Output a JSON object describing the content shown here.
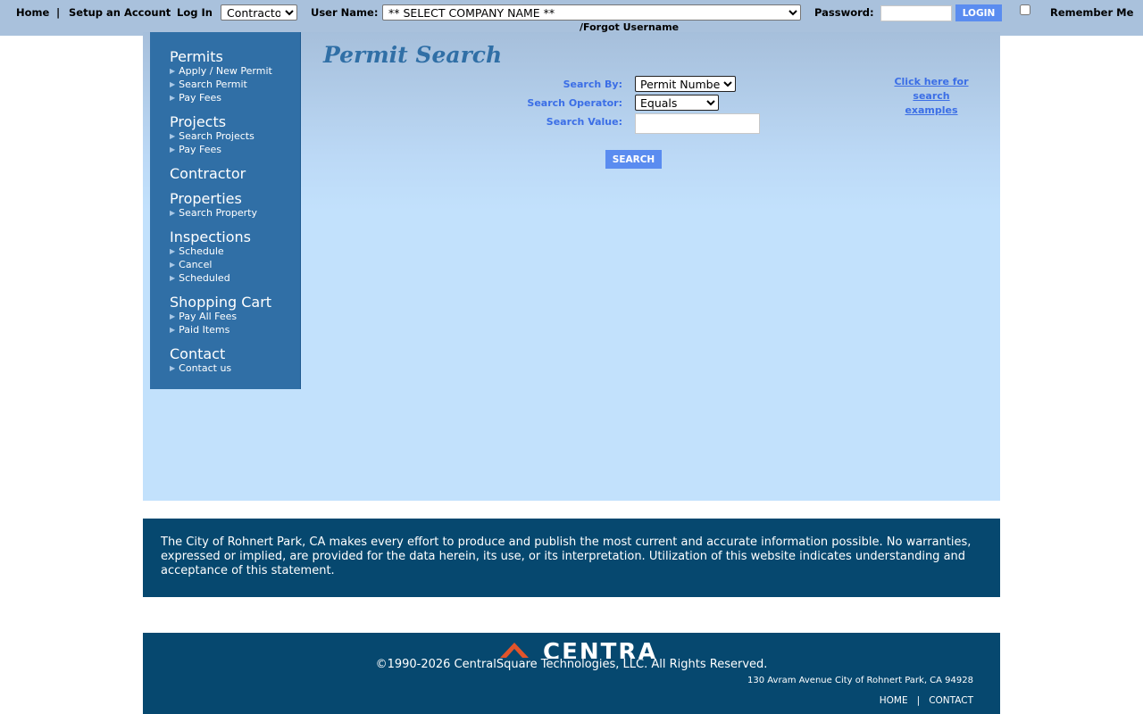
{
  "topbar": {
    "home": "Home",
    "sep1": "|",
    "setup": "Setup an Account",
    "login_label": "Log In",
    "login_type": "Contractor",
    "username_label": "User Name:",
    "company_select": "** SELECT COMPANY NAME **",
    "password_label": "Password:",
    "login_button": "LOGIN",
    "remember": "Remember Me",
    "forgot": "/Forgot Username"
  },
  "sidebar": {
    "permits": {
      "title": "Permits",
      "items": [
        "Apply / New Permit",
        "Search Permit",
        "Pay Fees"
      ]
    },
    "projects": {
      "title": "Projects",
      "items": [
        "Search Projects",
        "Pay Fees"
      ]
    },
    "contractor": {
      "title": "Contractor"
    },
    "properties": {
      "title": "Properties",
      "items": [
        "Search Property"
      ]
    },
    "inspections": {
      "title": "Inspections",
      "items": [
        "Schedule",
        "Cancel",
        "Scheduled"
      ]
    },
    "cart": {
      "title": "Shopping Cart",
      "items": [
        "Pay All Fees",
        "Paid Items"
      ]
    },
    "contact": {
      "title": "Contact",
      "items": [
        "Contact us"
      ]
    }
  },
  "main": {
    "title": "Permit Search",
    "search_by_label": "Search By:",
    "search_by_value": "Permit Number",
    "operator_label": "Search Operator:",
    "operator_value": "Equals",
    "value_label": "Search Value:",
    "search_value": "",
    "search_button": "SEARCH",
    "examples_link": "Click here for search examples"
  },
  "disclaimer": "The City of Rohnert Park, CA makes every effort to produce and publish the most current and accurate information possible. No warranties, expressed or implied, are provided for the data herein, its use, or its interpretation. Utilization of this website indicates understanding and acceptance of this statement.",
  "footer": {
    "logo_text": "CENTRA",
    "copyright": "©1990-2026 CentralSquare Technologies, LLC. All Rights Reserved.",
    "address": "130 Avram Avenue City of Rohnert Park, CA 94928",
    "home": "HOME",
    "sep": "|",
    "contact": "CONTACT"
  },
  "colors": {
    "accent": "#306fa6",
    "button": "#5a8cf0",
    "label": "#3b6ee6",
    "footer_bg": "#06486f",
    "topbar_bg": "#a9c1dc"
  }
}
